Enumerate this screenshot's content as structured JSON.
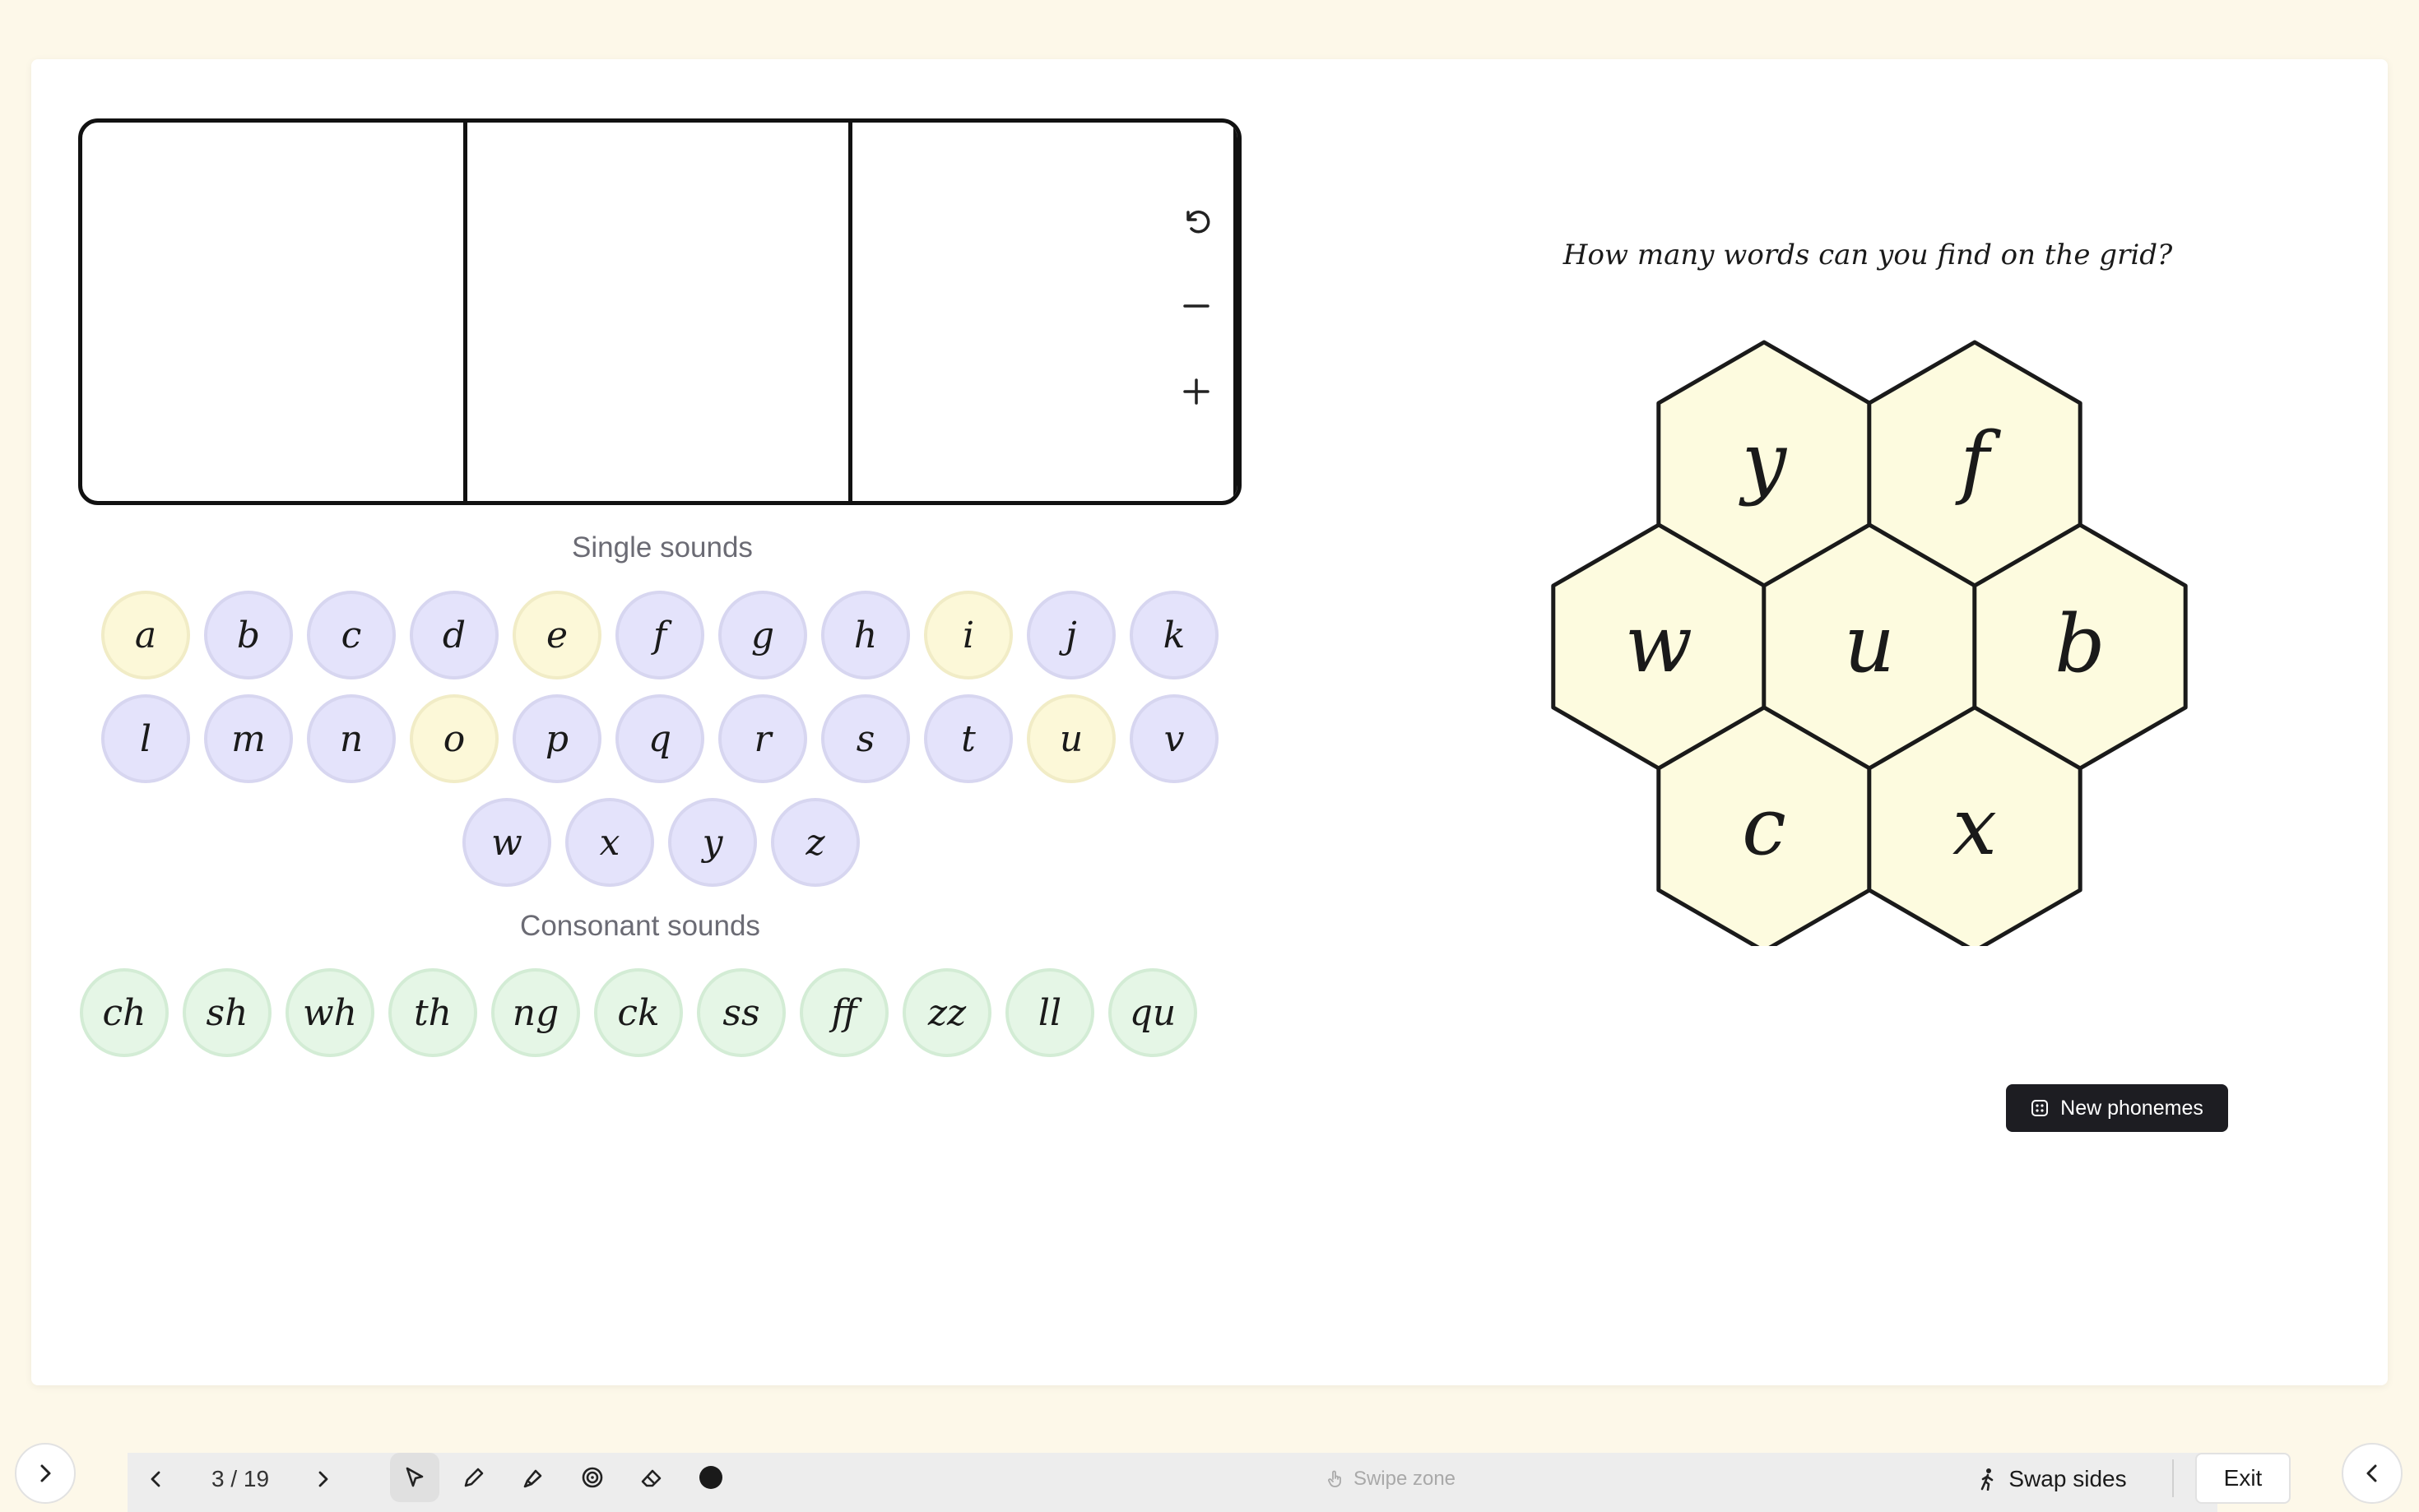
{
  "board": {
    "boxes": 3
  },
  "single_sounds": {
    "label": "Single sounds",
    "rows": [
      [
        {
          "t": "a",
          "kind": "vowel"
        },
        {
          "t": "b",
          "kind": "cons"
        },
        {
          "t": "c",
          "kind": "cons"
        },
        {
          "t": "d",
          "kind": "cons"
        },
        {
          "t": "e",
          "kind": "vowel"
        },
        {
          "t": "f",
          "kind": "cons"
        },
        {
          "t": "g",
          "kind": "cons"
        },
        {
          "t": "h",
          "kind": "cons"
        },
        {
          "t": "i",
          "kind": "vowel"
        },
        {
          "t": "j",
          "kind": "cons"
        },
        {
          "t": "k",
          "kind": "cons"
        }
      ],
      [
        {
          "t": "l",
          "kind": "cons"
        },
        {
          "t": "m",
          "kind": "cons"
        },
        {
          "t": "n",
          "kind": "cons"
        },
        {
          "t": "o",
          "kind": "vowel"
        },
        {
          "t": "p",
          "kind": "cons"
        },
        {
          "t": "q",
          "kind": "cons"
        },
        {
          "t": "r",
          "kind": "cons"
        },
        {
          "t": "s",
          "kind": "cons"
        },
        {
          "t": "t",
          "kind": "cons"
        },
        {
          "t": "u",
          "kind": "vowel"
        },
        {
          "t": "v",
          "kind": "cons"
        }
      ],
      [
        {
          "t": "w",
          "kind": "cons"
        },
        {
          "t": "x",
          "kind": "cons"
        },
        {
          "t": "y",
          "kind": "cons"
        },
        {
          "t": "z",
          "kind": "cons"
        }
      ]
    ]
  },
  "consonant_sounds": {
    "label": "Consonant sounds",
    "items": [
      "ch",
      "sh",
      "wh",
      "th",
      "ng",
      "ck",
      "ss",
      "ff",
      "zz",
      "ll",
      "qu"
    ]
  },
  "grid": {
    "question": "How many words can you find on the grid?",
    "cells": [
      "y",
      "f",
      "w",
      "u",
      "b",
      "c",
      "x"
    ]
  },
  "new_phonemes_label": "New phonemes",
  "toolbar": {
    "page": "3 / 19",
    "swipe_zone": "Swipe zone",
    "swap_sides": "Swap sides",
    "exit": "Exit"
  },
  "colors": {
    "consonant": "#e4e3fb",
    "vowel": "#fcf8d8",
    "digraph": "#e5f6e6",
    "hex_fill": "#fdfbdf",
    "background": "#fdf8e9"
  }
}
